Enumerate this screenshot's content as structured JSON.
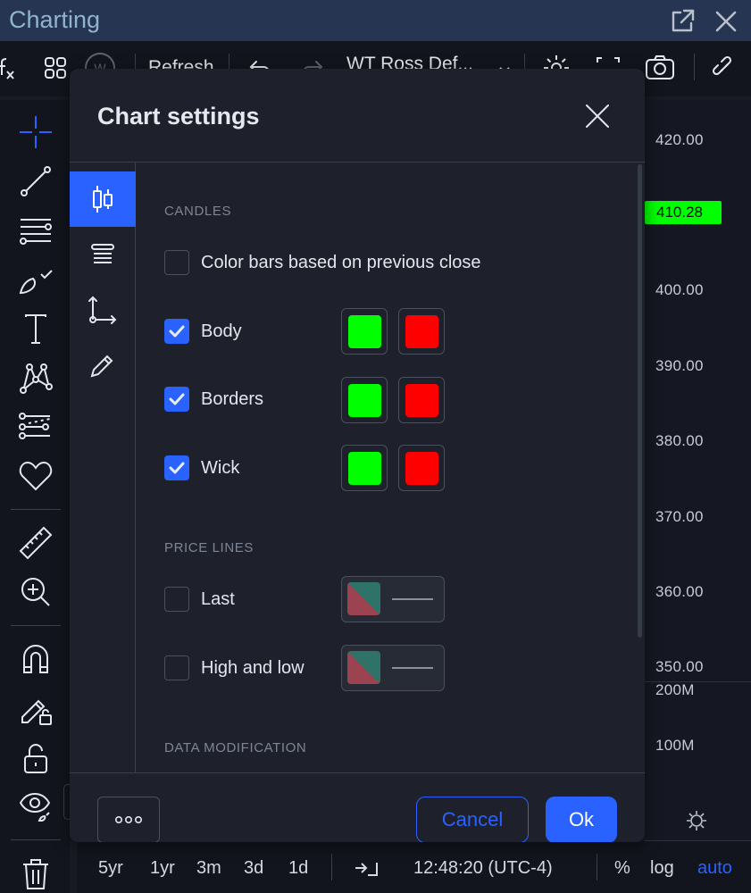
{
  "window": {
    "title": "Charting",
    "icons": [
      "external-link-icon",
      "close-icon"
    ]
  },
  "toolbar": {
    "refresh_label": "Refresh",
    "symbol_label": "WT Ross Def...",
    "indicator_badge": "W",
    "icons": [
      "function-icon",
      "grid-icon",
      "indicator-w-icon",
      "undo-icon",
      "redo-icon",
      "chevron-down-icon",
      "gear-icon",
      "fullscreen-icon",
      "camera-icon",
      "link-icon"
    ]
  },
  "left_tools": [
    {
      "name": "crosshair",
      "active": true
    },
    {
      "name": "trend-line"
    },
    {
      "name": "fib-lines"
    },
    {
      "name": "brush"
    },
    {
      "name": "text"
    },
    {
      "name": "pattern"
    },
    {
      "name": "prediction"
    },
    {
      "name": "favorites"
    },
    {
      "name": "ruler"
    },
    {
      "name": "zoom-in"
    },
    {
      "name": "magnet"
    },
    {
      "name": "lock-drawing"
    },
    {
      "name": "lock"
    },
    {
      "name": "hide"
    },
    {
      "name": "trash"
    }
  ],
  "price_axis": {
    "labels": [
      "420.00",
      "400.00",
      "390.00",
      "380.00",
      "370.00",
      "360.00",
      "350.00"
    ],
    "current_price": "410.28",
    "current_price_color": "#00ff00",
    "volume_labels": [
      "200M",
      "100M"
    ]
  },
  "bottom_bar": {
    "ranges": [
      "5yr",
      "1yr",
      "3m",
      "3d",
      "1d"
    ],
    "time": "12:48:20 (UTC-4)",
    "percent_label": "%",
    "log_label": "log",
    "auto_label": "auto"
  },
  "dialog": {
    "title": "Chart settings",
    "nav": [
      {
        "name": "symbol",
        "active": true
      },
      {
        "name": "status-line",
        "active": false
      },
      {
        "name": "scales",
        "active": false
      },
      {
        "name": "appearance",
        "active": false
      }
    ],
    "sections": {
      "candles": "CANDLES",
      "price_lines": "PRICE LINES",
      "data_modification": "DATA MODIFICATION"
    },
    "candles": {
      "color_prev_close": {
        "label": "Color bars based on previous close",
        "checked": false
      },
      "rows": [
        {
          "label": "Body",
          "checked": true,
          "up_color": "#00ff00",
          "down_color": "#ff0000"
        },
        {
          "label": "Borders",
          "checked": true,
          "up_color": "#00ff00",
          "down_color": "#ff0000"
        },
        {
          "label": "Wick",
          "checked": true,
          "up_color": "#00ff00",
          "down_color": "#ff0000"
        }
      ]
    },
    "price_lines": [
      {
        "label": "Last",
        "checked": false,
        "color_a": "#2e7268",
        "color_b": "#9b4351"
      },
      {
        "label": "High and low",
        "checked": false,
        "color_a": "#2e7268",
        "color_b": "#9b4351"
      }
    ],
    "buttons": {
      "more_label": "ooo",
      "cancel_label": "Cancel",
      "ok_label": "Ok"
    },
    "accent_color": "#2962ff"
  }
}
